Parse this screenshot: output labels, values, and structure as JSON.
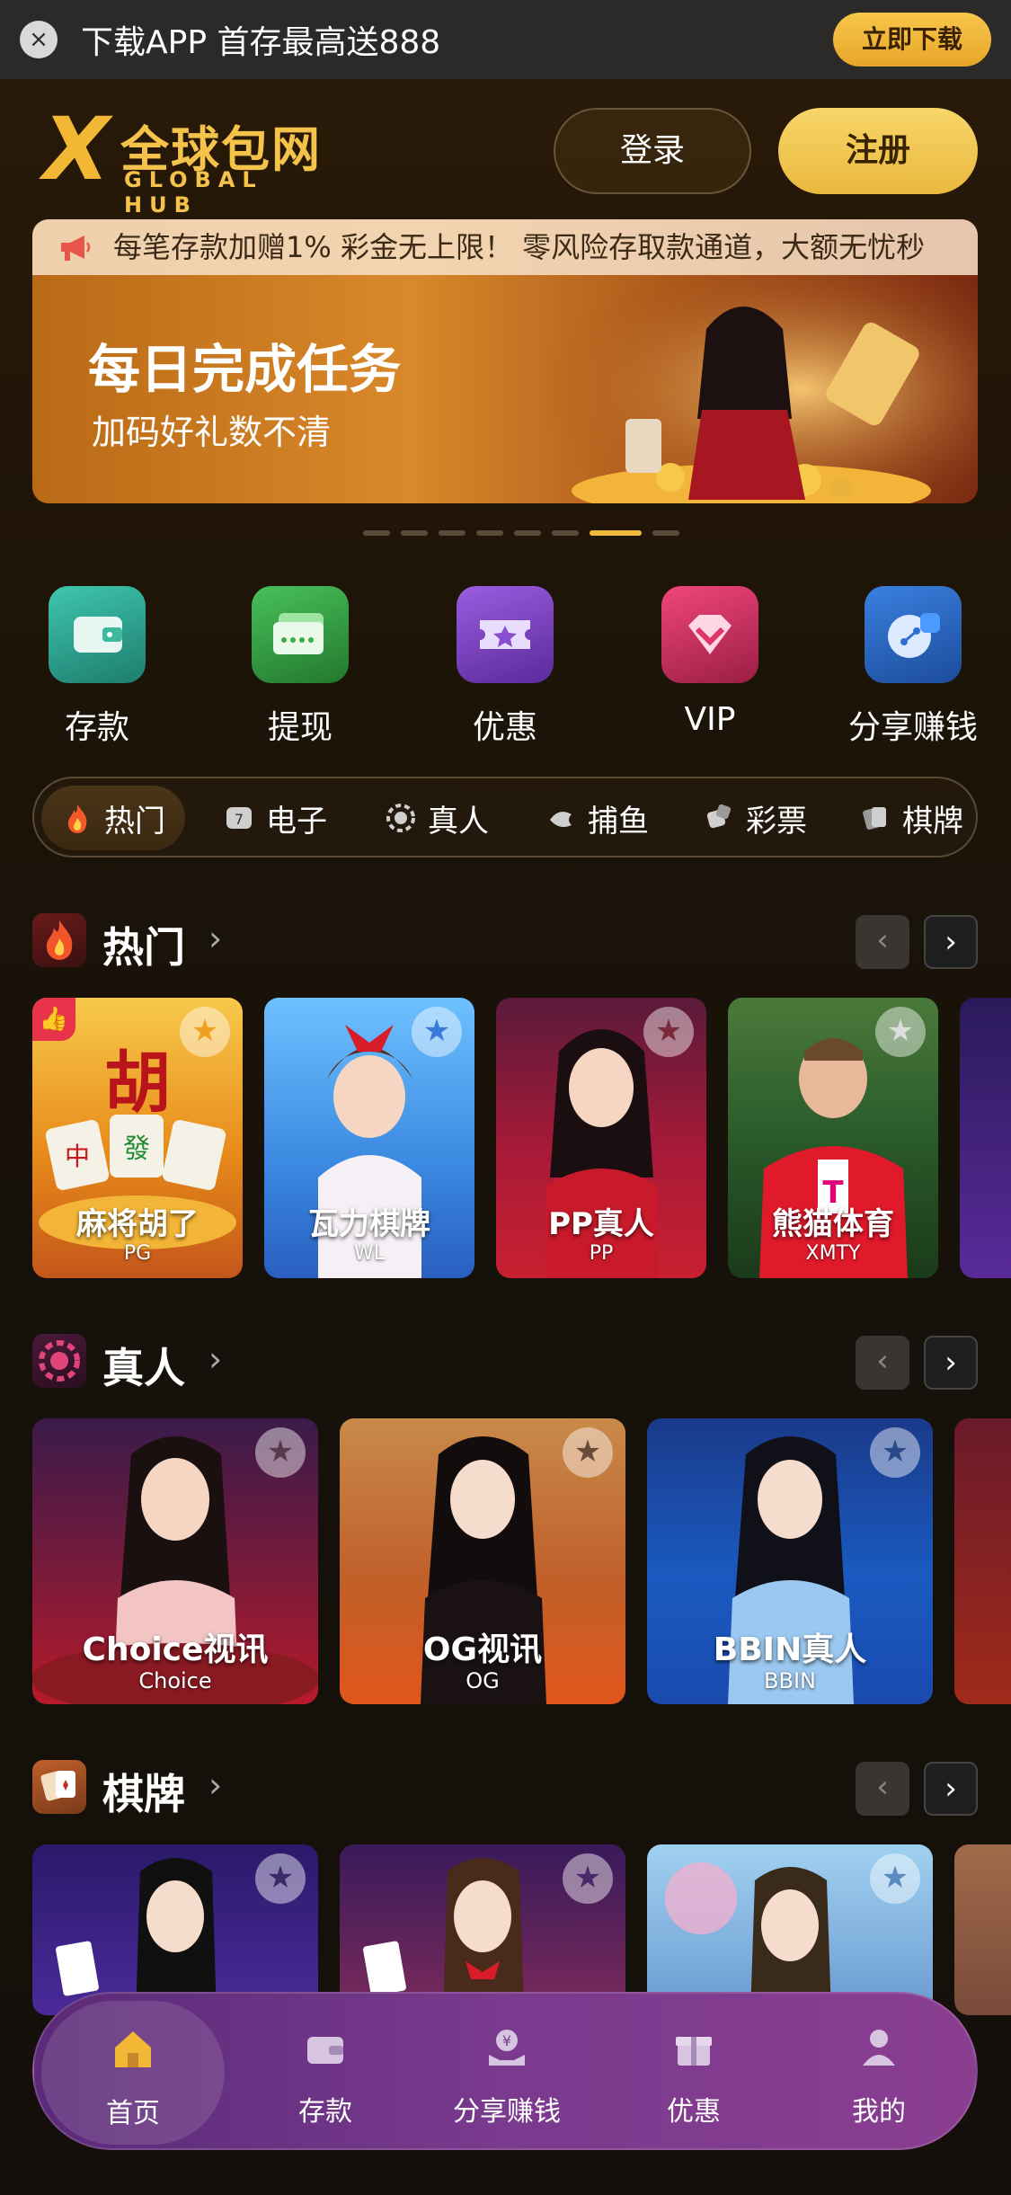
{
  "download_bar": {
    "close": "×",
    "text": "下载APP 首存最高送888",
    "button": "立即下载"
  },
  "header": {
    "logo_mark": "X",
    "logo_cn": "全球包网",
    "logo_en": "GLOBAL HUB",
    "login": "登录",
    "register": "注册"
  },
  "banner": {
    "marquee": "每笔存款加赠1% 彩金无上限！ 零风险存取款通道，大额无忧秒",
    "title": "每日完成任务",
    "subtitle": "加码好礼数不清",
    "slide_count": 8,
    "active_slide": 6
  },
  "quick_actions": [
    {
      "label": "存款",
      "icon": "wallet-icon",
      "color": "#3fb8a0"
    },
    {
      "label": "提现",
      "icon": "cash-card-icon",
      "color": "#3fae4a"
    },
    {
      "label": "优惠",
      "icon": "ticket-star-icon",
      "color": "#8a4fd0"
    },
    {
      "label": "VIP",
      "icon": "diamond-icon",
      "color": "#e0356a"
    },
    {
      "label": "分享赚钱",
      "icon": "share-icon",
      "color": "#2f6fd0"
    }
  ],
  "categories": [
    {
      "label": "热门",
      "icon": "flame-icon",
      "active": true
    },
    {
      "label": "电子",
      "icon": "slot-icon",
      "active": false
    },
    {
      "label": "真人",
      "icon": "chip-icon",
      "active": false
    },
    {
      "label": "捕鱼",
      "icon": "fish-icon",
      "active": false
    },
    {
      "label": "彩票",
      "icon": "dice-icon",
      "active": false
    },
    {
      "label": "棋牌",
      "icon": "cards-icon",
      "active": false
    }
  ],
  "sections": {
    "hot": {
      "title": "热门",
      "more": "›",
      "prev": "‹",
      "next": "›",
      "games": [
        {
          "name": "麻将胡了",
          "code": "PG",
          "fav": "★"
        },
        {
          "name": "瓦力棋牌",
          "code": "WL",
          "fav": "★"
        },
        {
          "name": "PP真人",
          "code": "PP",
          "fav": "★"
        },
        {
          "name": "熊猫体育",
          "code": "XMTY",
          "fav": "★"
        }
      ]
    },
    "live": {
      "title": "真人",
      "more": "›",
      "prev": "‹",
      "next": "›",
      "games": [
        {
          "name": "Choice视讯",
          "code": "Choice",
          "fav": "★"
        },
        {
          "name": "OG视讯",
          "code": "OG",
          "fav": "★"
        },
        {
          "name": "BBIN真人",
          "code": "BBIN",
          "fav": "★"
        }
      ]
    },
    "chess": {
      "title": "棋牌",
      "more": "›",
      "prev": "‹",
      "next": "›",
      "games": [
        {
          "fav": "★"
        },
        {
          "fav": "★"
        },
        {
          "fav": "★"
        }
      ]
    }
  },
  "bottom_nav": [
    {
      "label": "首页",
      "icon": "home-icon",
      "active": true
    },
    {
      "label": "存款",
      "icon": "wallet-icon",
      "active": false
    },
    {
      "label": "分享赚钱",
      "icon": "share-money-icon",
      "active": false
    },
    {
      "label": "优惠",
      "icon": "gift-icon",
      "active": false
    },
    {
      "label": "我的",
      "icon": "user-icon",
      "active": false
    }
  ],
  "colors": {
    "gold": "#f1b735",
    "nav_purple": "#7a3a8e",
    "hot_badge": "#e8334a"
  }
}
